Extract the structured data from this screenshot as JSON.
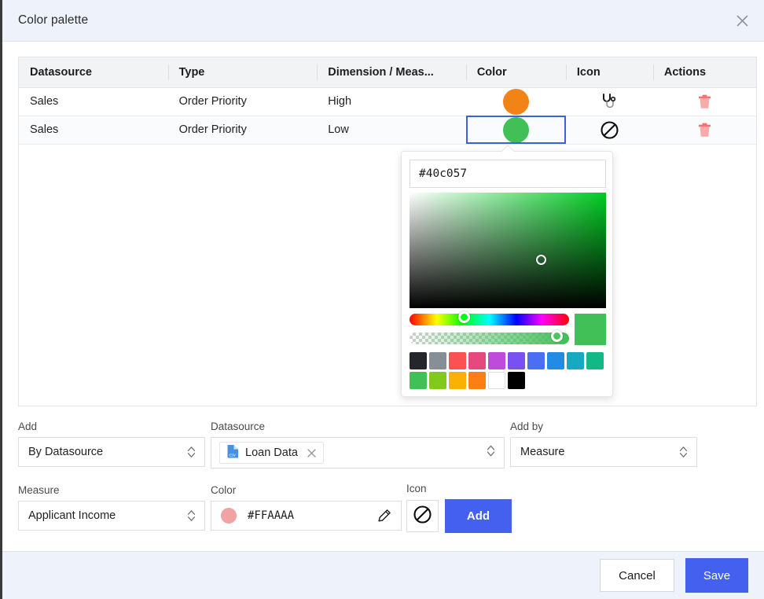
{
  "dialog": {
    "title": "Color palette",
    "close_icon": "close-icon"
  },
  "table": {
    "columns": [
      "Datasource",
      "Type",
      "Dimension / Meas...",
      "Color",
      "Icon",
      "Actions"
    ],
    "rows": [
      {
        "datasource": "Sales",
        "type": "Order Priority",
        "dimension": "High",
        "color": "#f28415",
        "icon": "stethoscope-icon",
        "action": "delete-icon"
      },
      {
        "datasource": "Sales",
        "type": "Order Priority",
        "dimension": "Low",
        "color": "#40c057",
        "icon": "ban-icon",
        "action": "delete-icon"
      }
    ]
  },
  "color_picker": {
    "hex_value": "#40c057",
    "hex_placeholder": "#000000",
    "preview_color": "#40c057",
    "saturation_gradient_base": "#00cc22",
    "swatches": [
      "#25262b",
      "#868e96",
      "#fa5252",
      "#e64980",
      "#be4bdb",
      "#7950f2",
      "#4c6ef5",
      "#228be6",
      "#15aabf",
      "#12b886",
      "#40c057",
      "#82c91e",
      "#fab005",
      "#fd7e14",
      "#ffffff",
      "#000000"
    ]
  },
  "form": {
    "add": {
      "label": "Add",
      "value": "By Datasource"
    },
    "datasource": {
      "label": "Datasource",
      "chip": "Loan Data",
      "chip_icon": "csv-file-icon",
      "chip_remove_icon": "close-icon"
    },
    "add_by": {
      "label": "Add by",
      "value": "Measure"
    },
    "measure": {
      "label": "Measure",
      "value": "Applicant Income"
    },
    "color": {
      "label": "Color",
      "value": "#FFAAAA",
      "dot_color": "#f2a2a2",
      "edit_icon": "pencil-icon"
    },
    "icon": {
      "label": "Icon",
      "value": "ban-icon"
    },
    "add_button": "Add"
  },
  "footer": {
    "cancel": "Cancel",
    "save": "Save"
  },
  "colors": {
    "accent": "#4361ee",
    "header_bg": "#eef2fb",
    "selected_border": "#3b62d8",
    "trash": "#f98e8e"
  }
}
